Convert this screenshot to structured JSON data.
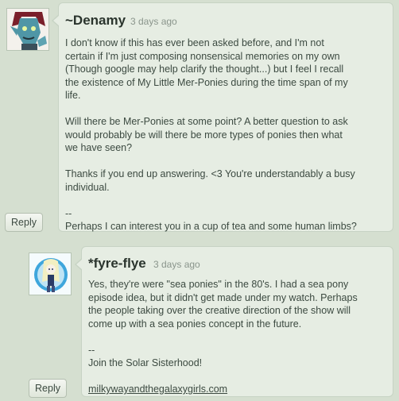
{
  "comments": [
    {
      "author": "~Denamy",
      "time": "3 days ago",
      "avatar_icon": "troll-avatar-icon",
      "reply_label": "Reply",
      "lines": [
        "I don't know if this has ever been asked before, and I'm not",
        "certain if I'm just composing nonsensical memories on my own",
        "(Though google may help clarify the thought...) but I feel I recall",
        "the existence of My Little Mer-Ponies during the time span of my",
        "life.",
        "",
        "Will there be Mer-Ponies at some point? A better question to ask",
        "would probably be will there be more types of ponies then what",
        "we have seen?",
        "",
        "Thanks if you end up answering. <3 You're understandably a busy",
        "individual.",
        "",
        "--",
        "Perhaps I can interest you in a cup of tea and some human limbs?"
      ]
    },
    {
      "author": "*fyre-flye",
      "time": "3 days ago",
      "avatar_icon": "pony-avatar-icon",
      "reply_label": "Reply",
      "lines": [
        "Yes, they're were \"sea ponies\" in the 80's. I had a sea pony",
        "episode idea, but it didn't get made under my watch. Perhaps",
        "the people taking over the creative direction of the show will",
        "come up with a sea ponies concept in the future.",
        "",
        "--",
        "Join the Solar Sisterhood!",
        ""
      ],
      "link": "milkywayandthegalaxygirls.com"
    }
  ]
}
